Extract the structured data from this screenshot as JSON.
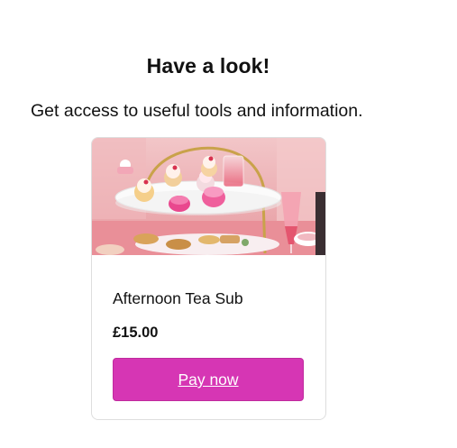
{
  "header": {
    "title": "Have a look!",
    "subtitle": "Get access to useful tools and information."
  },
  "product_card": {
    "image_subject": "afternoon-tea-stand-photo",
    "name": "Afternoon Tea Sub",
    "price": "£15.00",
    "button_label": "Pay now"
  },
  "colors": {
    "button_background": "#d636b4",
    "button_text": "#ffffff",
    "card_border": "#dedede"
  }
}
